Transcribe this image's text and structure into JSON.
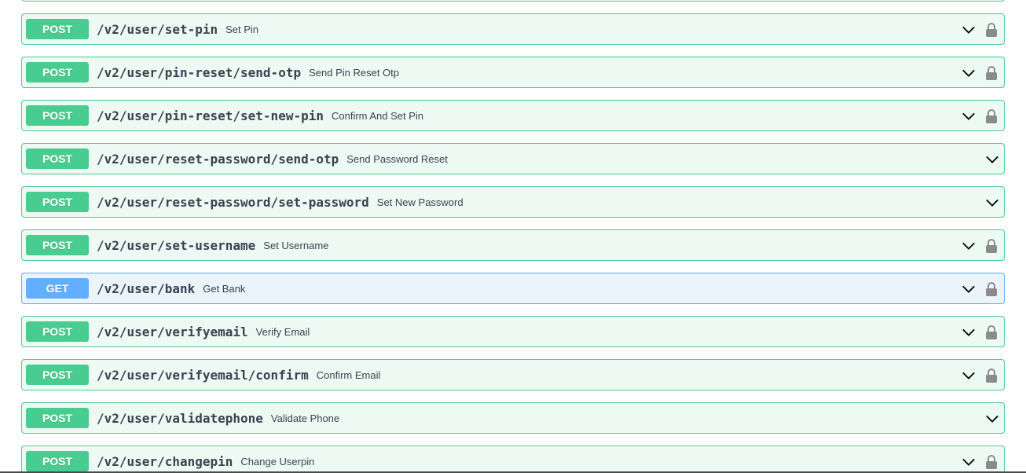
{
  "operations": [
    {
      "method": "POST",
      "path": "/v2/user/set-pin",
      "summary": "Set Pin",
      "lock": true
    },
    {
      "method": "POST",
      "path": "/v2/user/pin-reset/send-otp",
      "summary": "Send Pin Reset Otp",
      "lock": true
    },
    {
      "method": "POST",
      "path": "/v2/user/pin-reset/set-new-pin",
      "summary": "Confirm And Set Pin",
      "lock": true
    },
    {
      "method": "POST",
      "path": "/v2/user/reset-password/send-otp",
      "summary": "Send Password Reset",
      "lock": false
    },
    {
      "method": "POST",
      "path": "/v2/user/reset-password/set-password",
      "summary": "Set New Password",
      "lock": false
    },
    {
      "method": "POST",
      "path": "/v2/user/set-username",
      "summary": "Set Username",
      "lock": true
    },
    {
      "method": "GET",
      "path": "/v2/user/bank",
      "summary": "Get Bank",
      "lock": true
    },
    {
      "method": "POST",
      "path": "/v2/user/verifyemail",
      "summary": "Verify Email",
      "lock": true
    },
    {
      "method": "POST",
      "path": "/v2/user/verifyemail/confirm",
      "summary": "Confirm Email",
      "lock": true
    },
    {
      "method": "POST",
      "path": "/v2/user/validatephone",
      "summary": "Validate Phone",
      "lock": false
    },
    {
      "method": "POST",
      "path": "/v2/user/changepin",
      "summary": "Change Userpin",
      "lock": true
    }
  ],
  "colors": {
    "post": "#49cc90",
    "post_bg": "#edfaf3",
    "get": "#61affe",
    "get_bg": "#ebf3fb",
    "text": "#3b4151",
    "icon": "#8b8b8b"
  },
  "icons": {
    "expand": "chevron-down-icon",
    "auth": "lock-icon"
  }
}
